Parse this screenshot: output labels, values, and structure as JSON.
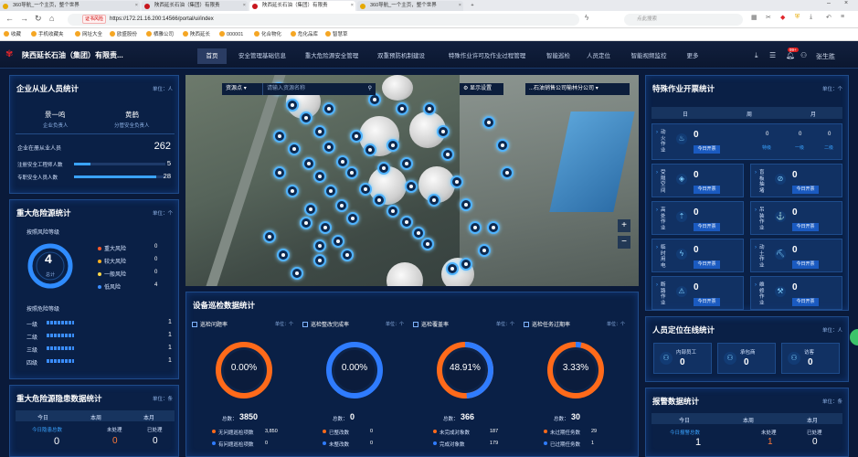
{
  "browser": {
    "tabs": [
      {
        "title": "360导航_一个主页，整个世界"
      },
      {
        "title": "陕西延长石油（集团）有限责"
      },
      {
        "title": "陕西延长石油（集团）有限责"
      },
      {
        "title": "360导航_一个主页，整个世界"
      }
    ],
    "url_tag": "证书风险",
    "url": "https://172.21.16.200:14566/portal/ui/index",
    "search_placeholder": "点此搜索",
    "bookmarks": [
      "收藏",
      "手机收藏夹",
      "网址大全",
      "欧盛股份",
      "栖雅公司",
      "陕西延长",
      "000001",
      "化合物化",
      "危化品库",
      "智慧草"
    ]
  },
  "app": {
    "title": "陕西延长石油（集团）有限责...",
    "nav": [
      "首页",
      "安全管理基础信息",
      "重大危险源安全管理",
      "双重预防机制建设",
      "特殊作业许可及作业过程管理",
      "智能巡检",
      "人员定位",
      "智能视频监控",
      "更多"
    ],
    "badge": "99+",
    "user": "张生胜"
  },
  "personnel": {
    "title": "企业从业人员统计",
    "unit": "单位：人",
    "leaders": [
      {
        "name": "景一鸣",
        "role": "企业负责人"
      },
      {
        "name": "黄鹤",
        "role": "分管安全负责人"
      }
    ],
    "total_label": "企业在册从业人员",
    "total": "262",
    "rows": [
      {
        "label": "注册安全工程师人数",
        "value": "5",
        "fill": 0.18
      },
      {
        "label": "专职安全人员人数",
        "value": "28",
        "fill": 0.9
      }
    ]
  },
  "hazard": {
    "title": "重大危险源统计",
    "unit": "单位：个",
    "by_risk_label": "按照风险等级",
    "total": "4",
    "total_label": "总计",
    "risks": [
      {
        "label": "重大风险",
        "value": "0",
        "color": "#ff5a2a"
      },
      {
        "label": "较大风险",
        "value": "0",
        "color": "#ffb020"
      },
      {
        "label": "一般风险",
        "value": "0",
        "color": "#ffd84a"
      },
      {
        "label": "低风险",
        "value": "4",
        "color": "#3a8dff"
      }
    ],
    "by_level_label": "按照危险等级",
    "levels": [
      {
        "label": "一级",
        "value": "1"
      },
      {
        "label": "二级",
        "value": "1"
      },
      {
        "label": "三级",
        "value": "1"
      },
      {
        "label": "四级",
        "value": "1"
      }
    ]
  },
  "hidden_danger": {
    "title": "重大危险源隐患数据统计",
    "unit": "单位：条",
    "tabs": [
      "今日",
      "本周",
      "本月"
    ],
    "labels": [
      "今日隐患总数",
      "未处理",
      "已处理"
    ],
    "values": [
      "0",
      "0",
      "0"
    ]
  },
  "map": {
    "resource_label": "资源点",
    "search_placeholder": "请输入资源名称",
    "display_settings": "显示设置",
    "company": "...石油销售公司榆林分公司",
    "zoom_in": "+",
    "zoom_out": "−"
  },
  "inspection": {
    "title": "设备巡检数据统计",
    "cards": [
      {
        "title": "巡检问题率",
        "unit": "单位：个",
        "percent": "0.00%",
        "fill": 0.0,
        "total_label": "总数：",
        "total": "3850",
        "items": [
          {
            "label": "无问题巡检项数",
            "value": "3,850"
          },
          {
            "label": "有问题巡检项数",
            "value": "0"
          }
        ]
      },
      {
        "title": "巡检整改完成率",
        "unit": "单位：个",
        "percent": "0.00%",
        "fill": 0.0,
        "total_label": "总数：",
        "total": "0",
        "items": [
          {
            "label": "已整改数",
            "value": "0"
          },
          {
            "label": "未整改数",
            "value": "0"
          }
        ]
      },
      {
        "title": "巡检覆盖率",
        "unit": "单位：个",
        "percent": "48.91%",
        "fill": 0.4891,
        "total_label": "总数：",
        "total": "366",
        "items": [
          {
            "label": "未完成对象数",
            "value": "187"
          },
          {
            "label": "完成对象数",
            "value": "179"
          }
        ]
      },
      {
        "title": "巡检任务过期率",
        "unit": "单位：个",
        "percent": "3.33%",
        "fill": 0.0333,
        "total_label": "总数：",
        "total": "30",
        "items": [
          {
            "label": "未过期任务数",
            "value": "29"
          },
          {
            "label": "已过期任务数",
            "value": "1"
          }
        ]
      }
    ]
  },
  "special_ops": {
    "title": "特殊作业开票统计",
    "unit": "单位：个",
    "tabs": [
      "日",
      "周",
      "月"
    ],
    "btn": "今日开票",
    "first": {
      "name": "动火作业",
      "value": "0",
      "levels": [
        {
          "label": "特级",
          "value": "0"
        },
        {
          "label": "一级",
          "value": "0"
        },
        {
          "label": "二级",
          "value": "0"
        }
      ]
    },
    "items": [
      {
        "name": "受限空间",
        "value": "0",
        "icon": "confined-space-icon"
      },
      {
        "name": "盲板抽堵",
        "value": "0",
        "icon": "blind-plate-icon"
      },
      {
        "name": "高处作业",
        "value": "0",
        "icon": "height-work-icon"
      },
      {
        "name": "吊装作业",
        "value": "0",
        "icon": "crane-icon"
      },
      {
        "name": "临时用电",
        "value": "0",
        "icon": "electric-icon"
      },
      {
        "name": "动土作业",
        "value": "0",
        "icon": "excavation-icon"
      },
      {
        "name": "断路作业",
        "value": "0",
        "icon": "road-break-icon"
      },
      {
        "name": "维修作业",
        "value": "0",
        "icon": "repair-icon"
      }
    ]
  },
  "positioning": {
    "title": "人员定位在线统计",
    "unit": "单位：人",
    "items": [
      {
        "label": "内部员工",
        "value": "0"
      },
      {
        "label": "承包商",
        "value": "0"
      },
      {
        "label": "访客",
        "value": "0"
      }
    ]
  },
  "alarms": {
    "title": "报警数据统计",
    "unit": "单位：条",
    "tabs": [
      "今日",
      "本周",
      "本月"
    ],
    "labels": [
      "今日报警总数",
      "未处理",
      "已处理"
    ],
    "values": [
      "1",
      "1",
      "0"
    ]
  }
}
